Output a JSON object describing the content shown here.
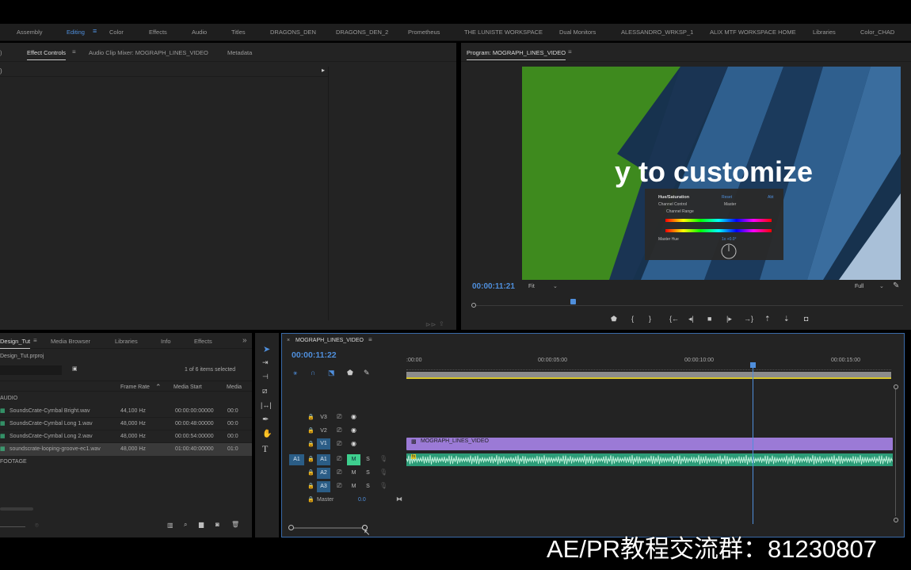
{
  "workspaces": [
    "Assembly",
    "Editing",
    "Color",
    "Effects",
    "Audio",
    "Titles",
    "DRAGONS_DEN",
    "DRAGONS_DEN_2",
    "Prometheus",
    "THE LUNISTE WORKSPACE",
    "Dual Monitors",
    "ALESSANDRO_WRKSP_1",
    "ALIX MTF WORKSPACE HOME",
    "Libraries",
    "Color_CHAD"
  ],
  "active_workspace": "Editing",
  "source_panel": {
    "tabs": [
      "Effect Controls",
      "Audio Clip Mixer: MOGRAPH_LINES_VIDEO",
      "Metadata"
    ],
    "active_tab": "Effect Controls"
  },
  "program_monitor": {
    "title": "Program: MOGRAPH_LINES_VIDEO",
    "timecode": "00:00:11:21",
    "zoom": "Fit",
    "quality": "Full",
    "playhead_fraction": 0.23,
    "video_text": "y to customize",
    "overlay": {
      "effect": "Hue/Saturation",
      "reset": "Reset",
      "abt": "Abt",
      "channel_control_label": "Channel Control",
      "channel_control_value": "Master",
      "channel_range_label": "Channel Range",
      "master_hue_label": "Master Hue",
      "master_hue_value": "1x +0.0°"
    },
    "colors": {
      "green": "#3e8a1e",
      "navy": "#17324e",
      "blue": "#2f5f8e",
      "light": "#a9c0d8"
    }
  },
  "project_panel": {
    "tabs": [
      "Design_Tut",
      "Media Browser",
      "Libraries",
      "Info",
      "Effects"
    ],
    "active_tab": "Design_Tut",
    "project_file": "Design_Tut.prproj",
    "items_selected": "1 of 6 items selected",
    "columns": [
      "Frame Rate",
      "Media Start",
      "Media"
    ],
    "bin_audio": "AUDIO",
    "bin_footage": "FOOTAGE",
    "rows": [
      {
        "name": "SoundsCrate-Cymbal Bright.wav",
        "rate": "44,100 Hz",
        "start": "00:00:00:00000",
        "media": "00:0"
      },
      {
        "name": "SoundsCrate-Cymbal Long 1.wav",
        "rate": "48,000 Hz",
        "start": "00:00:48:00000",
        "media": "00:0"
      },
      {
        "name": "SoundsCrate-Cymbal Long 2.wav",
        "rate": "48,000 Hz",
        "start": "00:00:54:00000",
        "media": "00:0"
      },
      {
        "name": "soundscrate-looping-groove-ec1.wav",
        "rate": "48,000 Hz",
        "start": "01:00:40:00000",
        "media": "01:0"
      }
    ],
    "selected_row": 3
  },
  "timeline": {
    "tab": "MOGRAPH_LINES_VIDEO",
    "timecode": "00:00:11:22",
    "ruler": [
      ":00:00",
      "00:00:05:00",
      "00:00:10:00",
      "00:00:15:00"
    ],
    "tracks": {
      "video": [
        "V3",
        "V2",
        "V1"
      ],
      "audio": [
        "A1",
        "A2",
        "A3"
      ],
      "source_patch": "A1",
      "master_label": "Master",
      "master_value": "0.0",
      "mute_label": "M",
      "solo_label": "S"
    },
    "video_clip": "MOGRAPH_LINES_VIDEO",
    "audio_clip_badge": "fx",
    "playhead_fraction": 0.71,
    "colors": {
      "video_clip": "#9b7ad6",
      "audio_clip": "#2c9c78",
      "work_area": "#d8c62a"
    }
  },
  "watermark": "AE/PR教程交流群：81230807"
}
